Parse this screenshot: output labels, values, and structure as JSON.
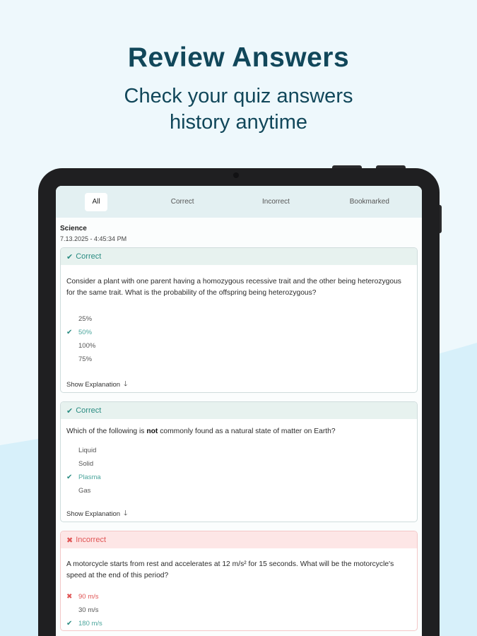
{
  "promo": {
    "title": "Review Answers",
    "subtitle_line1": "Check your quiz answers",
    "subtitle_line2": "history anytime"
  },
  "tabs": [
    {
      "label": "All",
      "active": true
    },
    {
      "label": "Correct"
    },
    {
      "label": "Incorrect"
    },
    {
      "label": "Bookmarked"
    }
  ],
  "quiz": {
    "subject": "Science",
    "timestamp": "7.13.2025 - 4:45:34 PM"
  },
  "cards": [
    {
      "status": "Correct",
      "question": "Consider a plant with one parent having a homozygous recessive trait and the other being heterozygous for the same trait. What is the probability of the offspring being heterozygous?",
      "options": [
        "25%",
        "50%",
        "100%",
        "75%"
      ],
      "explanation_label": "Show Explanation"
    },
    {
      "status": "Correct",
      "question_pre": "Which of the following is ",
      "question_bold": "not",
      "question_post": " commonly found as a natural state of matter on Earth?",
      "options": [
        "Liquid",
        "Solid",
        "Plasma",
        "Gas"
      ],
      "explanation_label": "Show Explanation"
    },
    {
      "status": "Incorrect",
      "question": "A motorcycle starts from rest and accelerates at 12 m/s² for 15 seconds. What will be the motorcycle's speed at the end of this period?",
      "options": [
        "90 m/s",
        "30 m/s",
        "180 m/s"
      ]
    }
  ],
  "icons": {
    "check": "check-icon",
    "cross": "x-icon",
    "arrow": "arrow-down-icon"
  },
  "colors": {
    "brand_dark": "#11475a",
    "correct": "#2a8c82",
    "incorrect": "#e05555",
    "background": "#eef8fc"
  }
}
